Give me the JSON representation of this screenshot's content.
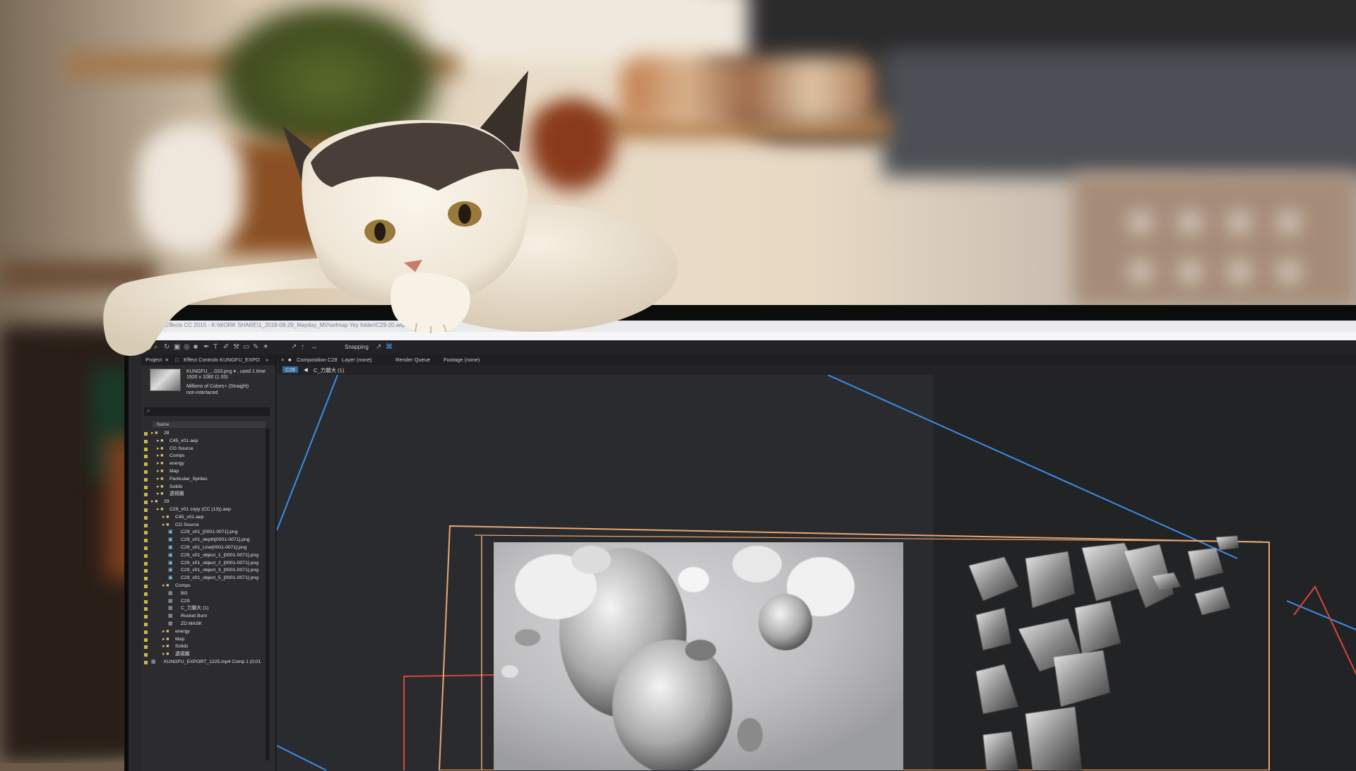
{
  "app": {
    "title": "Adobe After Effects CC 2015 - K:\\WORK SHARE\\1_2018-08-29_Mayday_MV\\selmap Yey folder\\C29-20.aep",
    "snapping_label": "Snapping"
  },
  "project_panel": {
    "tab_label": "Project",
    "effect_controls_label": "Effect Controls KUNGFU_EXPO",
    "selected_item": {
      "name": "KUNGFU_...033.png ▾ , used 1 time",
      "size": "1920 x 1080 (1.00)",
      "color_depth": "Millions of Colors+ (Straight)",
      "interlace": "non-interlaced"
    },
    "search_icon": "search-icon",
    "list_header": "Name",
    "items": [
      {
        "label": "28",
        "indent": 0,
        "type": "folder"
      },
      {
        "label": "C45_v01.aep",
        "indent": 1,
        "type": "folder"
      },
      {
        "label": "CG Source",
        "indent": 1,
        "type": "folder"
      },
      {
        "label": "Comps",
        "indent": 1,
        "type": "folder"
      },
      {
        "label": "energy",
        "indent": 1,
        "type": "folder"
      },
      {
        "label": "Map",
        "indent": 1,
        "type": "folder"
      },
      {
        "label": "Particular_Sprites",
        "indent": 1,
        "type": "folder"
      },
      {
        "label": "Solids",
        "indent": 1,
        "type": "folder"
      },
      {
        "label": "透視圖",
        "indent": 1,
        "type": "folder"
      },
      {
        "label": "29",
        "indent": 0,
        "type": "folder"
      },
      {
        "label": "C29_v01 copy (CC (13)).aep",
        "indent": 1,
        "type": "folder"
      },
      {
        "label": "C45_v01.aep",
        "indent": 2,
        "type": "folder"
      },
      {
        "label": "CG Source",
        "indent": 2,
        "type": "folder"
      },
      {
        "label": "C29_v01_[0001-0071].png",
        "indent": 3,
        "type": "file"
      },
      {
        "label": "C29_v01_depth[0001-0071].png",
        "indent": 3,
        "type": "file"
      },
      {
        "label": "C29_v01_Line[0001-0071].png",
        "indent": 3,
        "type": "file"
      },
      {
        "label": "C29_v01_object_1_[0001-0071].png",
        "indent": 3,
        "type": "file"
      },
      {
        "label": "C29_v01_object_2_[0001-0071].png",
        "indent": 3,
        "type": "file"
      },
      {
        "label": "C29_v01_object_3_[0001-0071].png",
        "indent": 3,
        "type": "file"
      },
      {
        "label": "C29_v01_object_5_[0001-0071].png",
        "indent": 3,
        "type": "file"
      },
      {
        "label": "Comps",
        "indent": 2,
        "type": "folder"
      },
      {
        "label": "BG",
        "indent": 3,
        "type": "comp"
      },
      {
        "label": "C29",
        "indent": 3,
        "type": "comp"
      },
      {
        "label": "C_力鎖大 (1)",
        "indent": 3,
        "type": "comp"
      },
      {
        "label": "Rocket Burn",
        "indent": 3,
        "type": "comp"
      },
      {
        "label": "ZD MASK",
        "indent": 3,
        "type": "comp"
      },
      {
        "label": "energy",
        "indent": 2,
        "type": "folder"
      },
      {
        "label": "Map",
        "indent": 2,
        "type": "folder"
      },
      {
        "label": "Solids",
        "indent": 2,
        "type": "folder"
      },
      {
        "label": "透視圖",
        "indent": 2,
        "type": "folder"
      },
      {
        "label": "KUNGFU_EXPORT_1225.mp4 Comp 1 (0;01",
        "indent": 0,
        "type": "comp"
      }
    ]
  },
  "composition": {
    "tab_label": "Composition C28",
    "layer_tab": "Layer (none)",
    "render_queue_tab": "Render Queue",
    "footage_tab": "Footage (none)",
    "active_comp_badge": "C28",
    "breadcrumb": "C_力鎖大 (1)"
  },
  "colors": {
    "guide_blue": "#3a8ee8",
    "comp_border_orange": "#e8a772",
    "mask_red": "#d8453c"
  }
}
